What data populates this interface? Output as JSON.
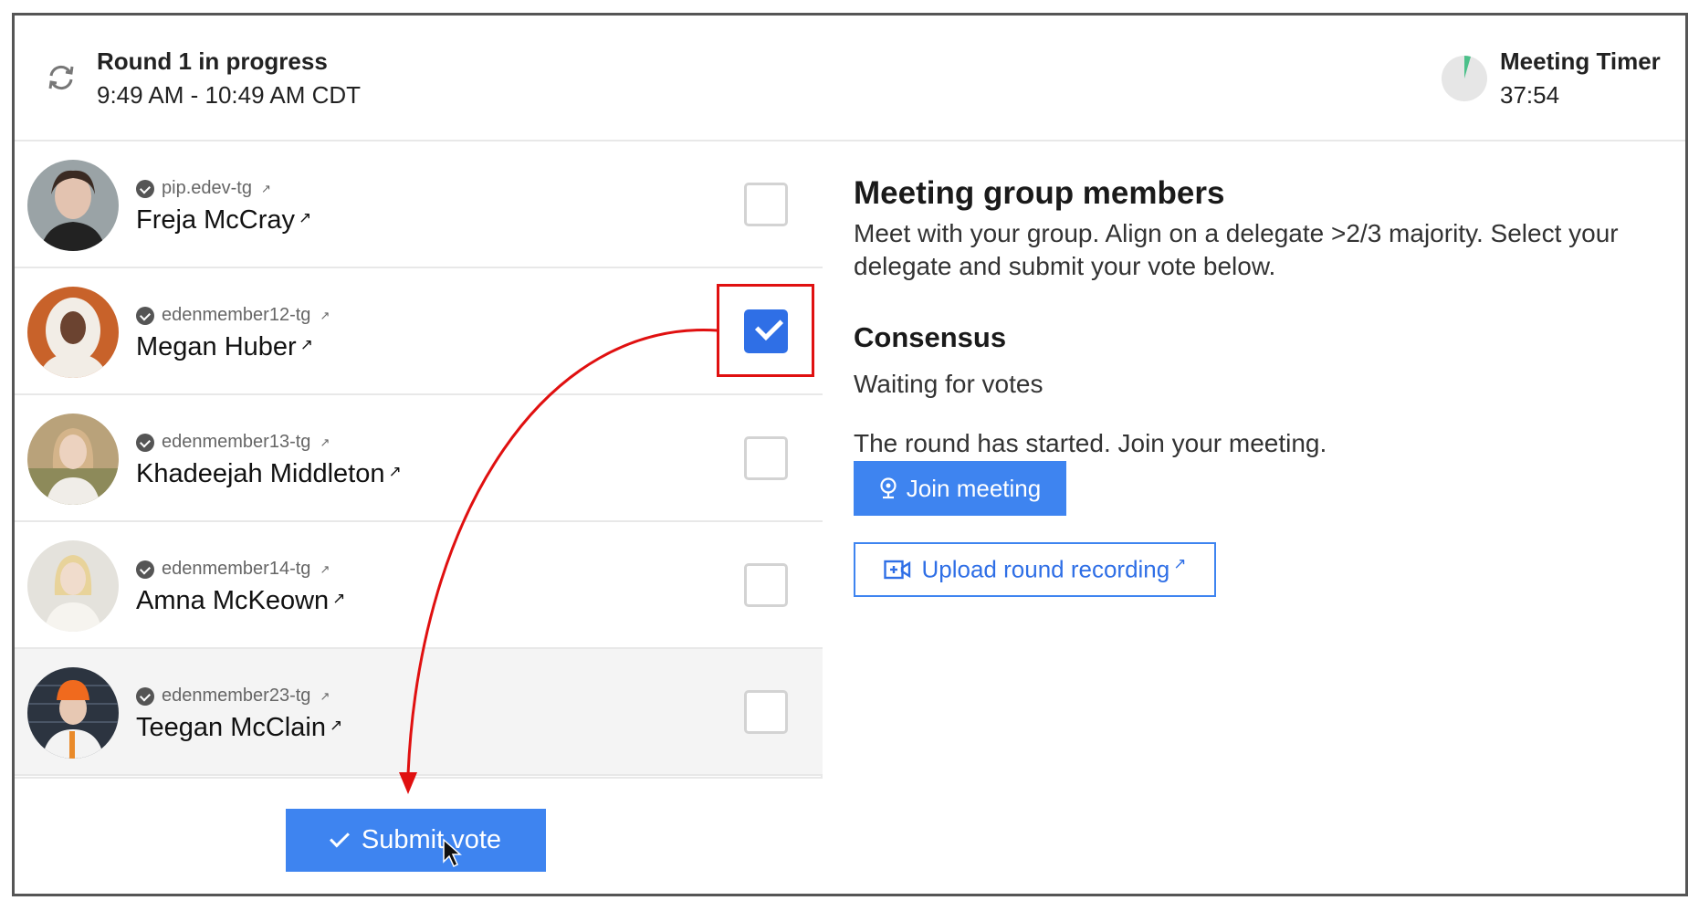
{
  "header": {
    "round_title": "Round 1 in progress",
    "round_time": "9:49 AM - 10:49 AM CDT",
    "timer_label": "Meeting Timer",
    "timer_value": "37:54"
  },
  "members": [
    {
      "handle": "pip.edev-tg",
      "name": "Freja McCray",
      "checked": false
    },
    {
      "handle": "edenmember12-tg",
      "name": "Megan Huber",
      "checked": true
    },
    {
      "handle": "edenmember13-tg",
      "name": "Khadeejah Middleton",
      "checked": false
    },
    {
      "handle": "edenmember14-tg",
      "name": "Amna McKeown",
      "checked": false
    },
    {
      "handle": "edenmember23-tg",
      "name": "Teegan McClain",
      "checked": false
    }
  ],
  "external_glyph": "↗",
  "submit_label": "Submit vote",
  "right": {
    "title": "Meeting group members",
    "description": "Meet with your group. Align on a delegate >2/3 majority. Select your delegate and submit your vote below.",
    "consensus_heading": "Consensus",
    "consensus_status": "Waiting for votes",
    "round_message": "The round has started. Join your meeting.",
    "join_label": "Join meeting",
    "upload_label": "Upload round recording"
  },
  "colors": {
    "accent": "#3e84f0",
    "highlight": "#e01010",
    "timer_fill": "#4cc08a"
  }
}
